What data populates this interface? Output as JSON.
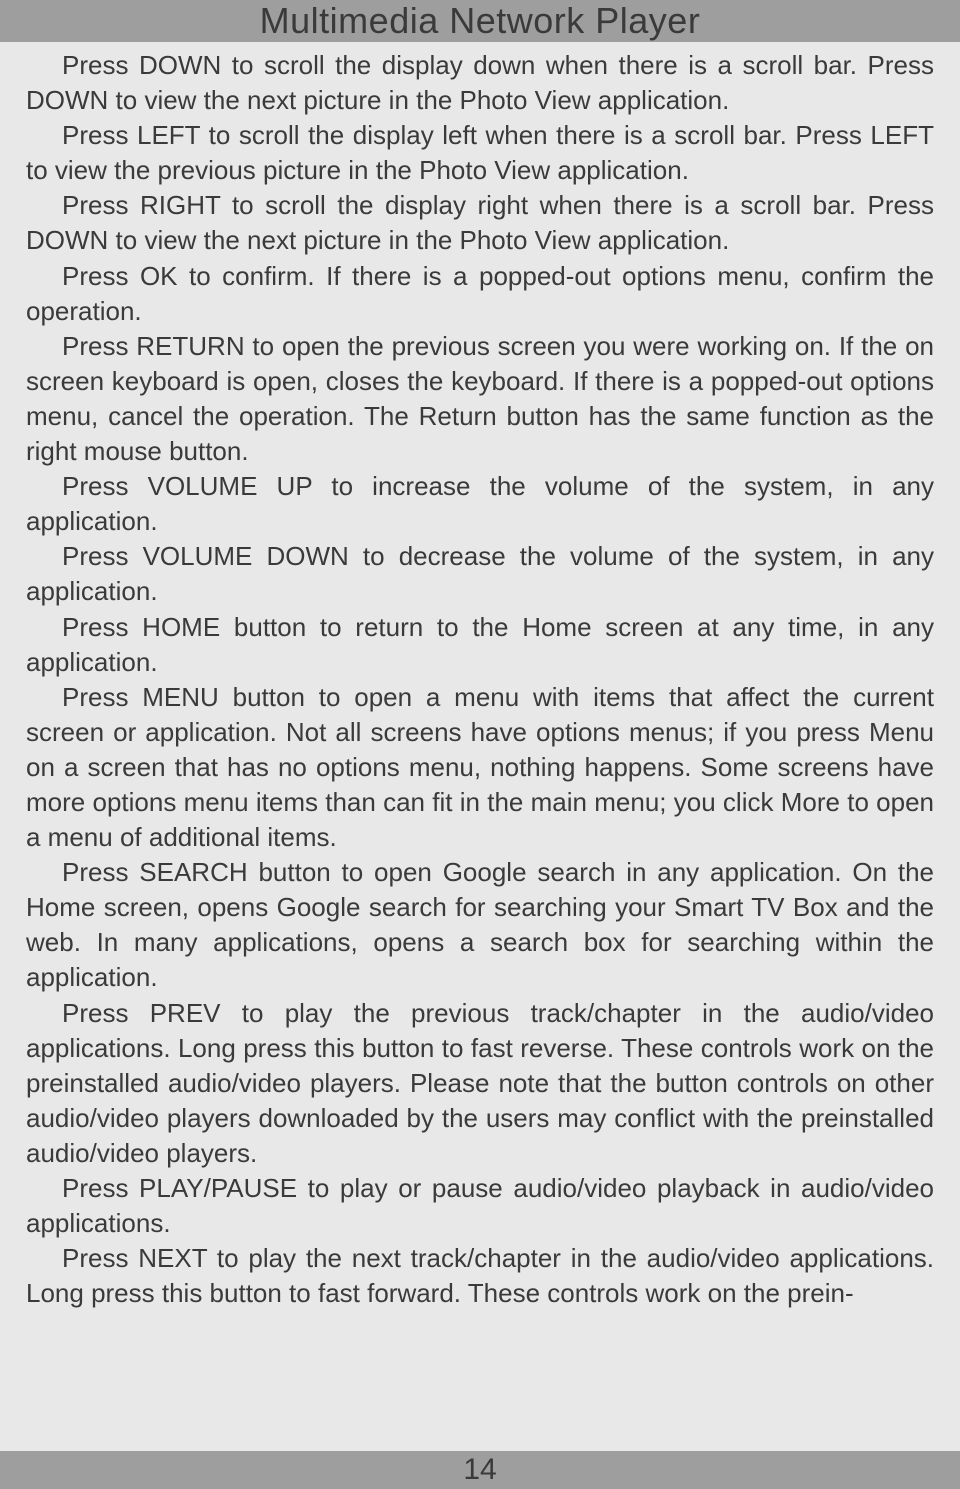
{
  "header": {
    "title": "Multimedia Network Player"
  },
  "paragraphs": [
    "Press DOWN to scroll the display down when there is a scroll bar. Press DOWN to view the next picture in the Photo View application.",
    "Press LEFT to scroll the display left when there is a scroll bar. Press LEFT to view the previous picture in the Photo View application.",
    "Press RIGHT to scroll the display right when there is a scroll bar. Press DOWN to view the next picture in the Photo View application.",
    "Press OK to confirm. If there is a popped-out options menu, confirm the operation.",
    "Press RETURN to open the previous screen you were working on. If the on screen keyboard is open, closes the keyboard. If there is a popped-out options menu, cancel the operation. The Return button has the same function as the right mouse button.",
    "Press VOLUME UP to increase the volume of the system, in any application.",
    "Press VOLUME DOWN to decrease the volume of the system, in any application.",
    "Press HOME button to return to the Home screen at any time, in any application.",
    "Press MENU button to open a menu with items that affect the current screen or application. Not all screens have options menus; if you press Menu on a screen that has no options menu, nothing happens. Some screens have more options menu items than can fit in the main menu; you click More to open a menu of additional items.",
    "Press SEARCH button to open Google search in any application. On the Home screen, opens Google search for searching your Smart TV Box and the web. In many applications, opens a search box for searching within the application.",
    "Press PREV to play the previous track/chapter in the audio/video applications. Long press this button to fast reverse. These controls work on the preinstalled audio/video players. Please note that the button controls on other audio/video players downloaded by the users may conflict with the preinstalled audio/video players.",
    "Press PLAY/PAUSE to play or pause audio/video playback in audio/video applications.",
    "Press NEXT to play the next track/chapter in the audio/video applications. Long press this button to fast forward. These controls work on the prein-"
  ],
  "footer": {
    "page_number": "14"
  }
}
